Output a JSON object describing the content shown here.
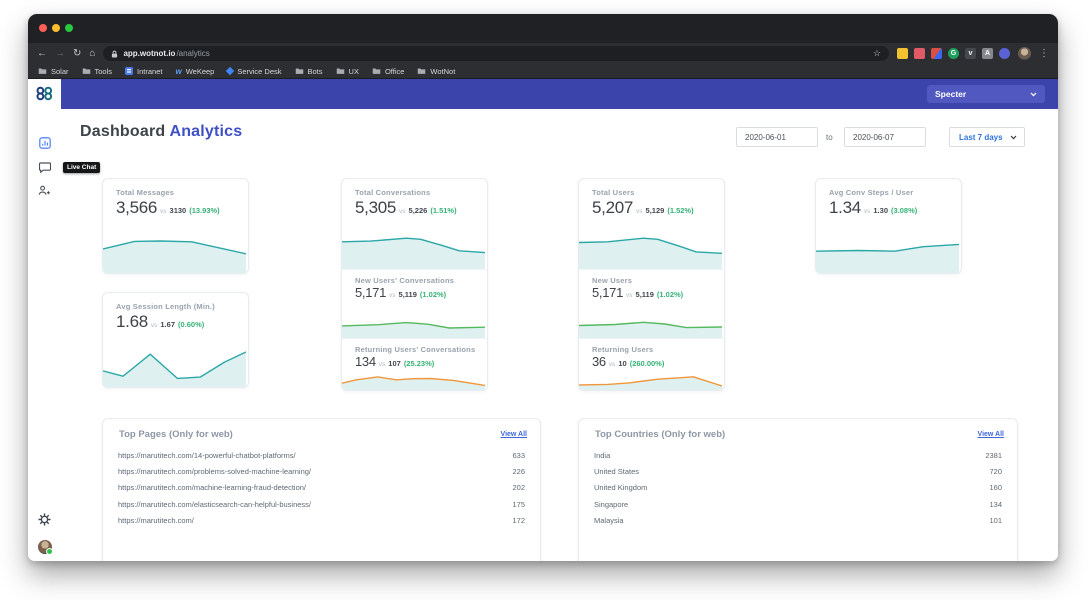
{
  "browser": {
    "url": {
      "host": "app.wotnot.io",
      "path": "/analytics"
    },
    "bookmarks": [
      {
        "label": "Solar",
        "icon": "folder"
      },
      {
        "label": "Tools",
        "icon": "folder"
      },
      {
        "label": "Intranet",
        "icon": "blue-grid"
      },
      {
        "label": "WeKeep",
        "icon": "blue-w"
      },
      {
        "label": "Service Desk",
        "icon": "blue-diamond"
      },
      {
        "label": "Bots",
        "icon": "folder"
      },
      {
        "label": "UX",
        "icon": "folder"
      },
      {
        "label": "Office",
        "icon": "folder"
      },
      {
        "label": "WotNot",
        "icon": "folder"
      }
    ],
    "extensions": [
      {
        "name": "notes-extension-icon",
        "color": "#f2c230",
        "shape": "square",
        "glyph": ""
      },
      {
        "name": "pen-extension-icon",
        "color": "#e25a68",
        "shape": "square",
        "glyph": ""
      },
      {
        "name": "creative-extension-icon",
        "color": "#d94f43",
        "shape": "split",
        "glyph": ""
      },
      {
        "name": "grammarly-extension-icon",
        "color": "#1fa05c",
        "shape": "circle",
        "glyph": "G"
      },
      {
        "name": "pocket-extension-icon",
        "color": "#45484d",
        "shape": "square",
        "glyph": "v"
      },
      {
        "name": "archive-extension-icon",
        "color": "#85888d",
        "shape": "square",
        "glyph": "A"
      },
      {
        "name": "discord-extension-icon",
        "color": "#5b62d6",
        "shape": "circle",
        "glyph": ""
      }
    ]
  },
  "app": {
    "workspace_button": "Specter",
    "page_title": {
      "primary": "Dashboard",
      "secondary": "Analytics"
    },
    "filters": {
      "date_from": "2020-06-01",
      "to_label": "to",
      "date_to": "2020-06-07",
      "range": "Last 7 days"
    },
    "tooltip": "Live Chat"
  },
  "stats": {
    "messages": {
      "label": "Total Messages",
      "value": "3,566",
      "vs": "vs",
      "compare": "3130",
      "pct": "(13.93%)",
      "line": "teal",
      "points": [
        [
          0,
          45
        ],
        [
          22,
          26
        ],
        [
          40,
          25
        ],
        [
          62,
          27
        ],
        [
          100,
          57
        ]
      ]
    },
    "session": {
      "label": "Avg Session Length (Min.)",
      "value": "1.68",
      "vs": "vs",
      "compare": "1.67",
      "pct": "(0.60%)",
      "line": "teal",
      "points": [
        [
          0,
          68
        ],
        [
          14,
          80
        ],
        [
          33,
          30
        ],
        [
          52,
          85
        ],
        [
          68,
          82
        ],
        [
          85,
          48
        ],
        [
          100,
          25
        ]
      ]
    },
    "conversations": {
      "label": "Total Conversations",
      "value": "5,305",
      "vs": "vs",
      "compare": "5,226",
      "pct": "(1.51%)",
      "line": "teal",
      "points": [
        [
          0,
          30
        ],
        [
          20,
          28
        ],
        [
          45,
          20
        ],
        [
          55,
          23
        ],
        [
          70,
          40
        ],
        [
          82,
          55
        ],
        [
          100,
          60
        ]
      ]
    },
    "new_conversations": {
      "label": "New Users' Conversations",
      "value": "5,171",
      "vs": "vs",
      "compare": "5,119",
      "pct": "(1.02%)",
      "line": "green",
      "points": [
        [
          0,
          52
        ],
        [
          25,
          46
        ],
        [
          45,
          36
        ],
        [
          60,
          44
        ],
        [
          75,
          62
        ],
        [
          100,
          58
        ]
      ]
    },
    "returning_conversations": {
      "label": "Returning Users' Conversations",
      "value": "134",
      "vs": "vs",
      "compare": "107",
      "pct": "(25.23%)",
      "line": "orange",
      "points": [
        [
          0,
          72
        ],
        [
          10,
          52
        ],
        [
          25,
          35
        ],
        [
          38,
          52
        ],
        [
          50,
          45
        ],
        [
          62,
          44
        ],
        [
          78,
          55
        ],
        [
          100,
          85
        ]
      ]
    },
    "users": {
      "label": "Total Users",
      "value": "5,207",
      "vs": "vs",
      "compare": "5,129",
      "pct": "(1.52%)",
      "line": "teal",
      "points": [
        [
          0,
          32
        ],
        [
          20,
          30
        ],
        [
          45,
          20
        ],
        [
          55,
          23
        ],
        [
          70,
          42
        ],
        [
          82,
          58
        ],
        [
          100,
          62
        ]
      ]
    },
    "new_users": {
      "label": "New Users",
      "value": "5,171",
      "vs": "vs",
      "compare": "5,119",
      "pct": "(1.02%)",
      "line": "green",
      "points": [
        [
          0,
          50
        ],
        [
          25,
          45
        ],
        [
          45,
          35
        ],
        [
          60,
          43
        ],
        [
          75,
          60
        ],
        [
          100,
          57
        ]
      ]
    },
    "returning_users": {
      "label": "Returning Users",
      "value": "36",
      "vs": "vs",
      "compare": "10",
      "pct": "(260.00%)",
      "line": "orange",
      "points": [
        [
          0,
          82
        ],
        [
          20,
          79
        ],
        [
          35,
          70
        ],
        [
          55,
          48
        ],
        [
          70,
          40
        ],
        [
          80,
          34
        ],
        [
          100,
          88
        ]
      ]
    },
    "steps": {
      "label": "Avg Conv Steps / User",
      "value": "1.34",
      "vs": "vs",
      "compare": "1.30",
      "pct": "(3.08%)",
      "line": "teal",
      "points": [
        [
          0,
          48
        ],
        [
          30,
          46
        ],
        [
          55,
          48
        ],
        [
          75,
          36
        ],
        [
          100,
          30
        ]
      ]
    }
  },
  "tables": {
    "top_pages": {
      "title": "Top Pages (Only for web)",
      "link": "View All",
      "rows": [
        {
          "label": "https://marutitech.com/14-powerful-chatbot-platforms/",
          "value": "633"
        },
        {
          "label": "https://marutitech.com/problems-solved-machine-learning/",
          "value": "226"
        },
        {
          "label": "https://marutitech.com/machine-learning-fraud-detection/",
          "value": "202"
        },
        {
          "label": "https://marutitech.com/elasticsearch-can-helpful-business/",
          "value": "175"
        },
        {
          "label": "https://marutitech.com/",
          "value": "172"
        }
      ]
    },
    "top_countries": {
      "title": "Top Countries (Only for web)",
      "link": "View All",
      "rows": [
        {
          "label": "India",
          "value": "2381"
        },
        {
          "label": "United States",
          "value": "720"
        },
        {
          "label": "United Kingdom",
          "value": "160"
        },
        {
          "label": "Singapore",
          "value": "134"
        },
        {
          "label": "Malaysia",
          "value": "101"
        }
      ]
    }
  },
  "colors": {
    "teal": "#2ca7a8",
    "green": "#55b95e",
    "orange": "#f0973b",
    "chart_fill": "#def0f0",
    "positive": "#35b276",
    "header": "#3b44ab"
  }
}
